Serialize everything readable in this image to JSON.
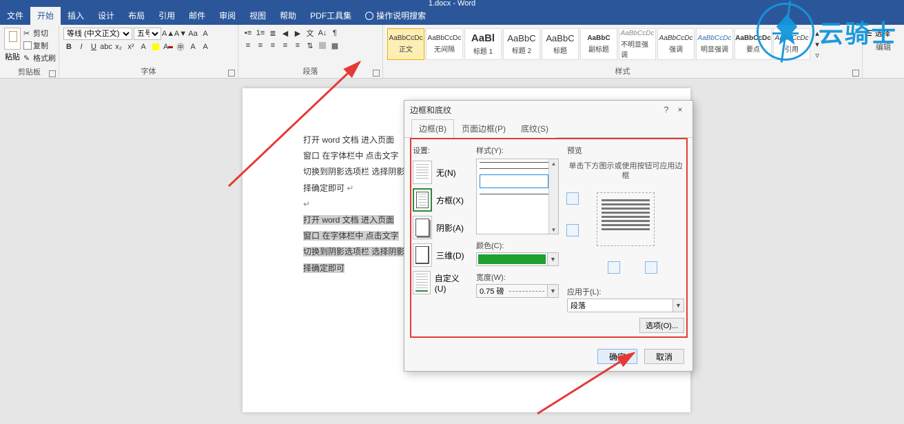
{
  "title": "1.docx - Word",
  "menu": {
    "file": "文件",
    "home": "开始",
    "insert": "插入",
    "design": "设计",
    "layout": "布局",
    "references": "引用",
    "mailings": "邮件",
    "review": "审阅",
    "view": "视图",
    "help": "帮助",
    "pdf": "PDF工具集",
    "tell": "操作说明搜索"
  },
  "ribbon": {
    "clipboard": {
      "label": "剪贴板",
      "paste": "粘贴",
      "cut": "剪切",
      "copy": "复制",
      "format_painter": "格式刷"
    },
    "font": {
      "label": "字体",
      "name": "等线 (中文正文)",
      "size": "五号"
    },
    "paragraph": {
      "label": "段落"
    },
    "styles": {
      "label": "样式",
      "items": [
        {
          "preview": "AaBbCcDc",
          "name": "正文"
        },
        {
          "preview": "AaBbCcDc",
          "name": "无间隔"
        },
        {
          "preview": "AaBl",
          "name": "标题 1"
        },
        {
          "preview": "AaBbC",
          "name": "标题 2"
        },
        {
          "preview": "AaBbC",
          "name": "标题"
        },
        {
          "preview": "AaBbC",
          "name": "副标题"
        },
        {
          "preview": "AaBbCcDc",
          "name": "不明显强调"
        },
        {
          "preview": "AaBbCcDc",
          "name": "强调"
        },
        {
          "preview": "AaBbCcDc",
          "name": "明显强调"
        },
        {
          "preview": "AaBbCcDc",
          "name": "要点"
        },
        {
          "preview": "AaBbCcDc",
          "name": "引用"
        }
      ]
    },
    "editing": {
      "label": "编辑",
      "select": "选择"
    }
  },
  "document": {
    "p1": "打开 word 文档    进入页面",
    "p2": "窗口    在字体栏中    点击文字",
    "p3": "切换到阴影选项栏    选择阴影",
    "p4": "择确定即可",
    "p5": "打开 word 文档    进入页面",
    "p6": "窗口    在字体栏中    点击文字",
    "p7": "切换到阴影选项栏    选择阴影",
    "p8": "择确定即可"
  },
  "dialog": {
    "title": "边框和底纹",
    "tabs": {
      "borders": "边框(B)",
      "page_borders": "页面边框(P)",
      "shading": "底纹(S)"
    },
    "setting_label": "设置:",
    "settings": {
      "none": "无(N)",
      "box": "方框(X)",
      "shadow": "阴影(A)",
      "threeD": "三维(D)",
      "custom": "自定义(U)"
    },
    "style_label": "样式(Y):",
    "color_label": "颜色(C):",
    "color_value": "#1fa02e",
    "width_label": "宽度(W):",
    "width_value": "0.75 磅",
    "preview_label": "预览",
    "preview_hint": "单击下方图示或使用按钮可应用边框",
    "apply_label": "应用于(L):",
    "apply_value": "段落",
    "options": "选项(O)...",
    "ok": "确定",
    "cancel": "取消",
    "help": "?",
    "close": "×"
  },
  "watermark": "云骑士"
}
